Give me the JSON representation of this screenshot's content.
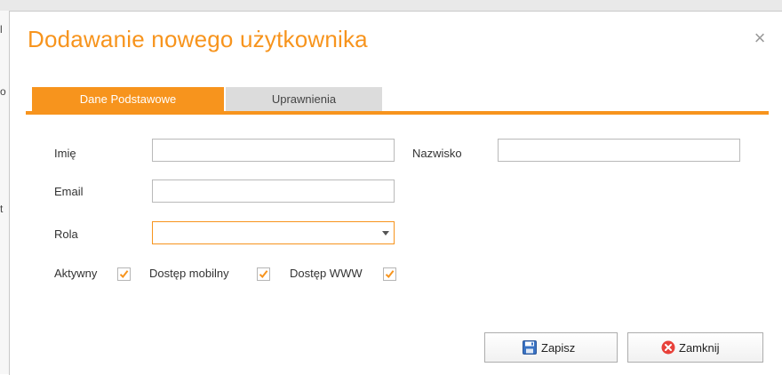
{
  "dialog": {
    "title": "Dodawanie nowego użytkownika",
    "close_glyph": "×"
  },
  "tabs": [
    {
      "label": "Dane Podstawowe",
      "active": true
    },
    {
      "label": "Uprawnienia",
      "active": false
    }
  ],
  "form": {
    "first_name": {
      "label": "Imię",
      "value": ""
    },
    "last_name": {
      "label": "Nazwisko",
      "value": ""
    },
    "email": {
      "label": "Email",
      "value": ""
    },
    "role": {
      "label": "Rola",
      "value": ""
    },
    "checkboxes": [
      {
        "label": "Aktywny",
        "checked": true
      },
      {
        "label": "Dostęp mobilny",
        "checked": true
      },
      {
        "label": "Dostęp WWW",
        "checked": true
      }
    ]
  },
  "buttons": {
    "save": {
      "label": "Zapisz",
      "icon": "floppy-disk-icon"
    },
    "close": {
      "label": "Zamknij",
      "icon": "close-circle-icon"
    }
  },
  "colors": {
    "accent": "#f7941d",
    "tab_inactive": "#dcdcdc",
    "close_icon": "#e8413a",
    "save_icon": "#3a73c4"
  },
  "background": {
    "fragments": [
      "l",
      "o",
      "t"
    ]
  }
}
